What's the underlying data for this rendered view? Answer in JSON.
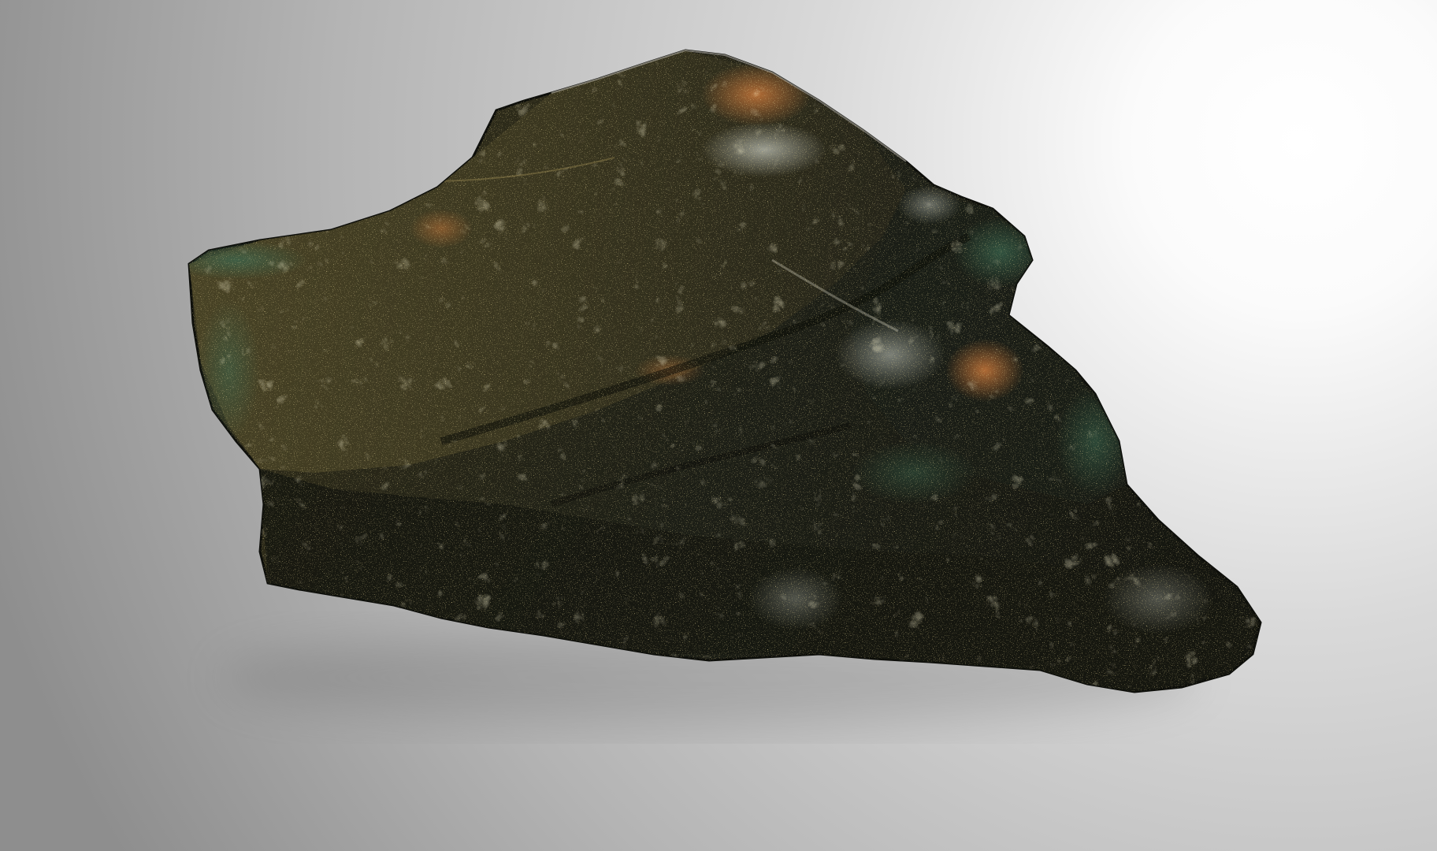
{
  "scene": {
    "subject": "dark-mineral-rock-specimen",
    "colors": {
      "background_dark": "#8d8d8d",
      "background_mid": "#c9c9c9",
      "background_light": "#ffffff",
      "rock_base": "#1e1f18",
      "rock_shadow": "#0c0d0a",
      "gold_sparkle": "#b89a48",
      "copper_highlight": "#b0622a",
      "green_tint": "#2e4a3a",
      "silver_highlight": "#d8dcd4"
    }
  }
}
